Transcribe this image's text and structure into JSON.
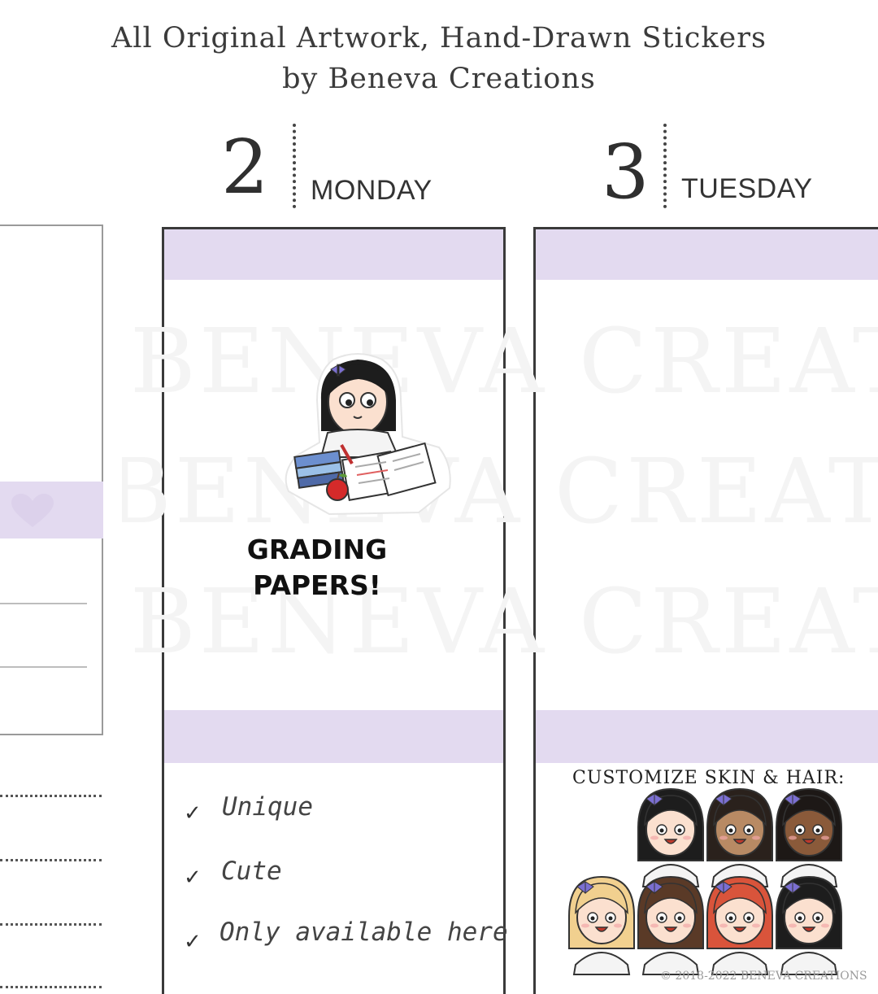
{
  "header": {
    "line1": "All Original Artwork, Hand-Drawn Stickers",
    "line2": "by Beneva Creations"
  },
  "days": [
    {
      "number": "2",
      "name": "MONDAY"
    },
    {
      "number": "3",
      "name": "TUESDAY"
    }
  ],
  "sticker": {
    "caption_line1": "GRADING",
    "caption_line2": "PAPERS!"
  },
  "features": [
    "Unique",
    "Cute",
    "Only available here"
  ],
  "customize": {
    "title": "CUSTOMIZE SKIN & HAIR:",
    "variants": [
      {
        "skin": "#fbe0cf",
        "hair": "#1d1d1d"
      },
      {
        "skin": "#b88a64",
        "hair": "#2a211c"
      },
      {
        "skin": "#8a5a3a",
        "hair": "#1d1816"
      },
      {
        "skin": "#fbe0cf",
        "hair": "#f1d08f"
      },
      {
        "skin": "#fbe0cf",
        "hair": "#5a3a27"
      },
      {
        "skin": "#fbe0cf",
        "hair": "#d9543b"
      },
      {
        "skin": "#fbe0cf",
        "hair": "#1d1d1d"
      }
    ]
  },
  "watermark": "BENEVA CREATI",
  "copyright": "© 2018-2022 BENEVA CREATIONS",
  "colors": {
    "accent_band": "#e3daf0",
    "heart": "#dcd1eb",
    "ribbon": "#7b6fd1"
  }
}
